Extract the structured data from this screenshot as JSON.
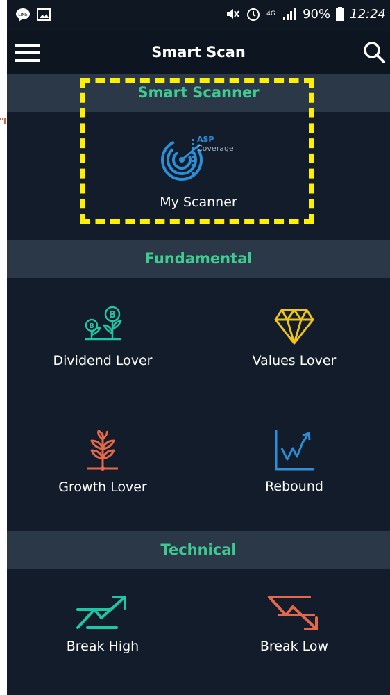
{
  "statusbar": {
    "signal_label": "4G",
    "battery": "90%",
    "time": "12:24"
  },
  "appbar": {
    "title": "Smart Scan"
  },
  "sections": {
    "smart_scanner": {
      "title": "Smart Scanner",
      "tiles": [
        {
          "label": "My Scanner",
          "icon": "radar-icon",
          "badge_top": "ASP",
          "badge_bottom": "Coverage"
        }
      ]
    },
    "fundamental": {
      "title": "Fundamental",
      "tiles": [
        {
          "label": "Dividend Lover",
          "icon": "coin-plant-icon"
        },
        {
          "label": "Values Lover",
          "icon": "diamond-icon"
        },
        {
          "label": "Growth Lover",
          "icon": "sprout-icon"
        },
        {
          "label": "Rebound",
          "icon": "rebound-chart-icon"
        }
      ]
    },
    "technical": {
      "title": "Technical",
      "tiles": [
        {
          "label": "Break High",
          "icon": "break-high-icon"
        },
        {
          "label": "Break Low",
          "icon": "break-low-icon"
        }
      ]
    }
  },
  "colors": {
    "background": "#131c2a",
    "header_bg": "#2b3848",
    "section_title": "#3fcb8f",
    "highlight_dash": "#ffef00",
    "radar_blue": "#2c8fd6",
    "gold": "#f0c419",
    "coral": "#e4694a",
    "teal": "#1fc6a3"
  }
}
